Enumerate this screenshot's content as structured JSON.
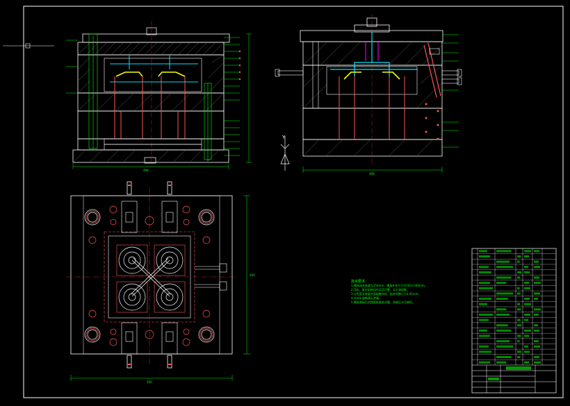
{
  "drawing": {
    "title_block_name": "",
    "colors": {
      "background": "#000000",
      "border": "#ffffff",
      "part_outline": "#ffffff",
      "dimension": "#00ff00",
      "centerline": "#ff3333",
      "pins_rods": "#ff5555",
      "cooling": "#00e5ff",
      "product": "#ffff00",
      "hatch": "#888888",
      "magenta": "#ff00ff"
    },
    "view_labels": {
      "top_view_width_dim": "498",
      "side_view_width_dim": "498",
      "plan_view_width_dim": "500",
      "plan_view_height_dim": "500",
      "arrow_label": "Y"
    },
    "notes": {
      "heading": "技术要求",
      "lines": [
        "1.模具闭合高度为350mm，模具外形尺寸为500×500mm。",
        "2.顶出、复位机构动作灵活可靠，无卡滞现象。",
        "3.分型面及各配合面接触良好，贴合间隙小于0.02mm。",
        "4.冷却水道畅通无渗漏。",
        "5.模具装配后应按图纸要求试模，合格后方可使用。"
      ]
    },
    "bom": {
      "rows": 22
    }
  }
}
